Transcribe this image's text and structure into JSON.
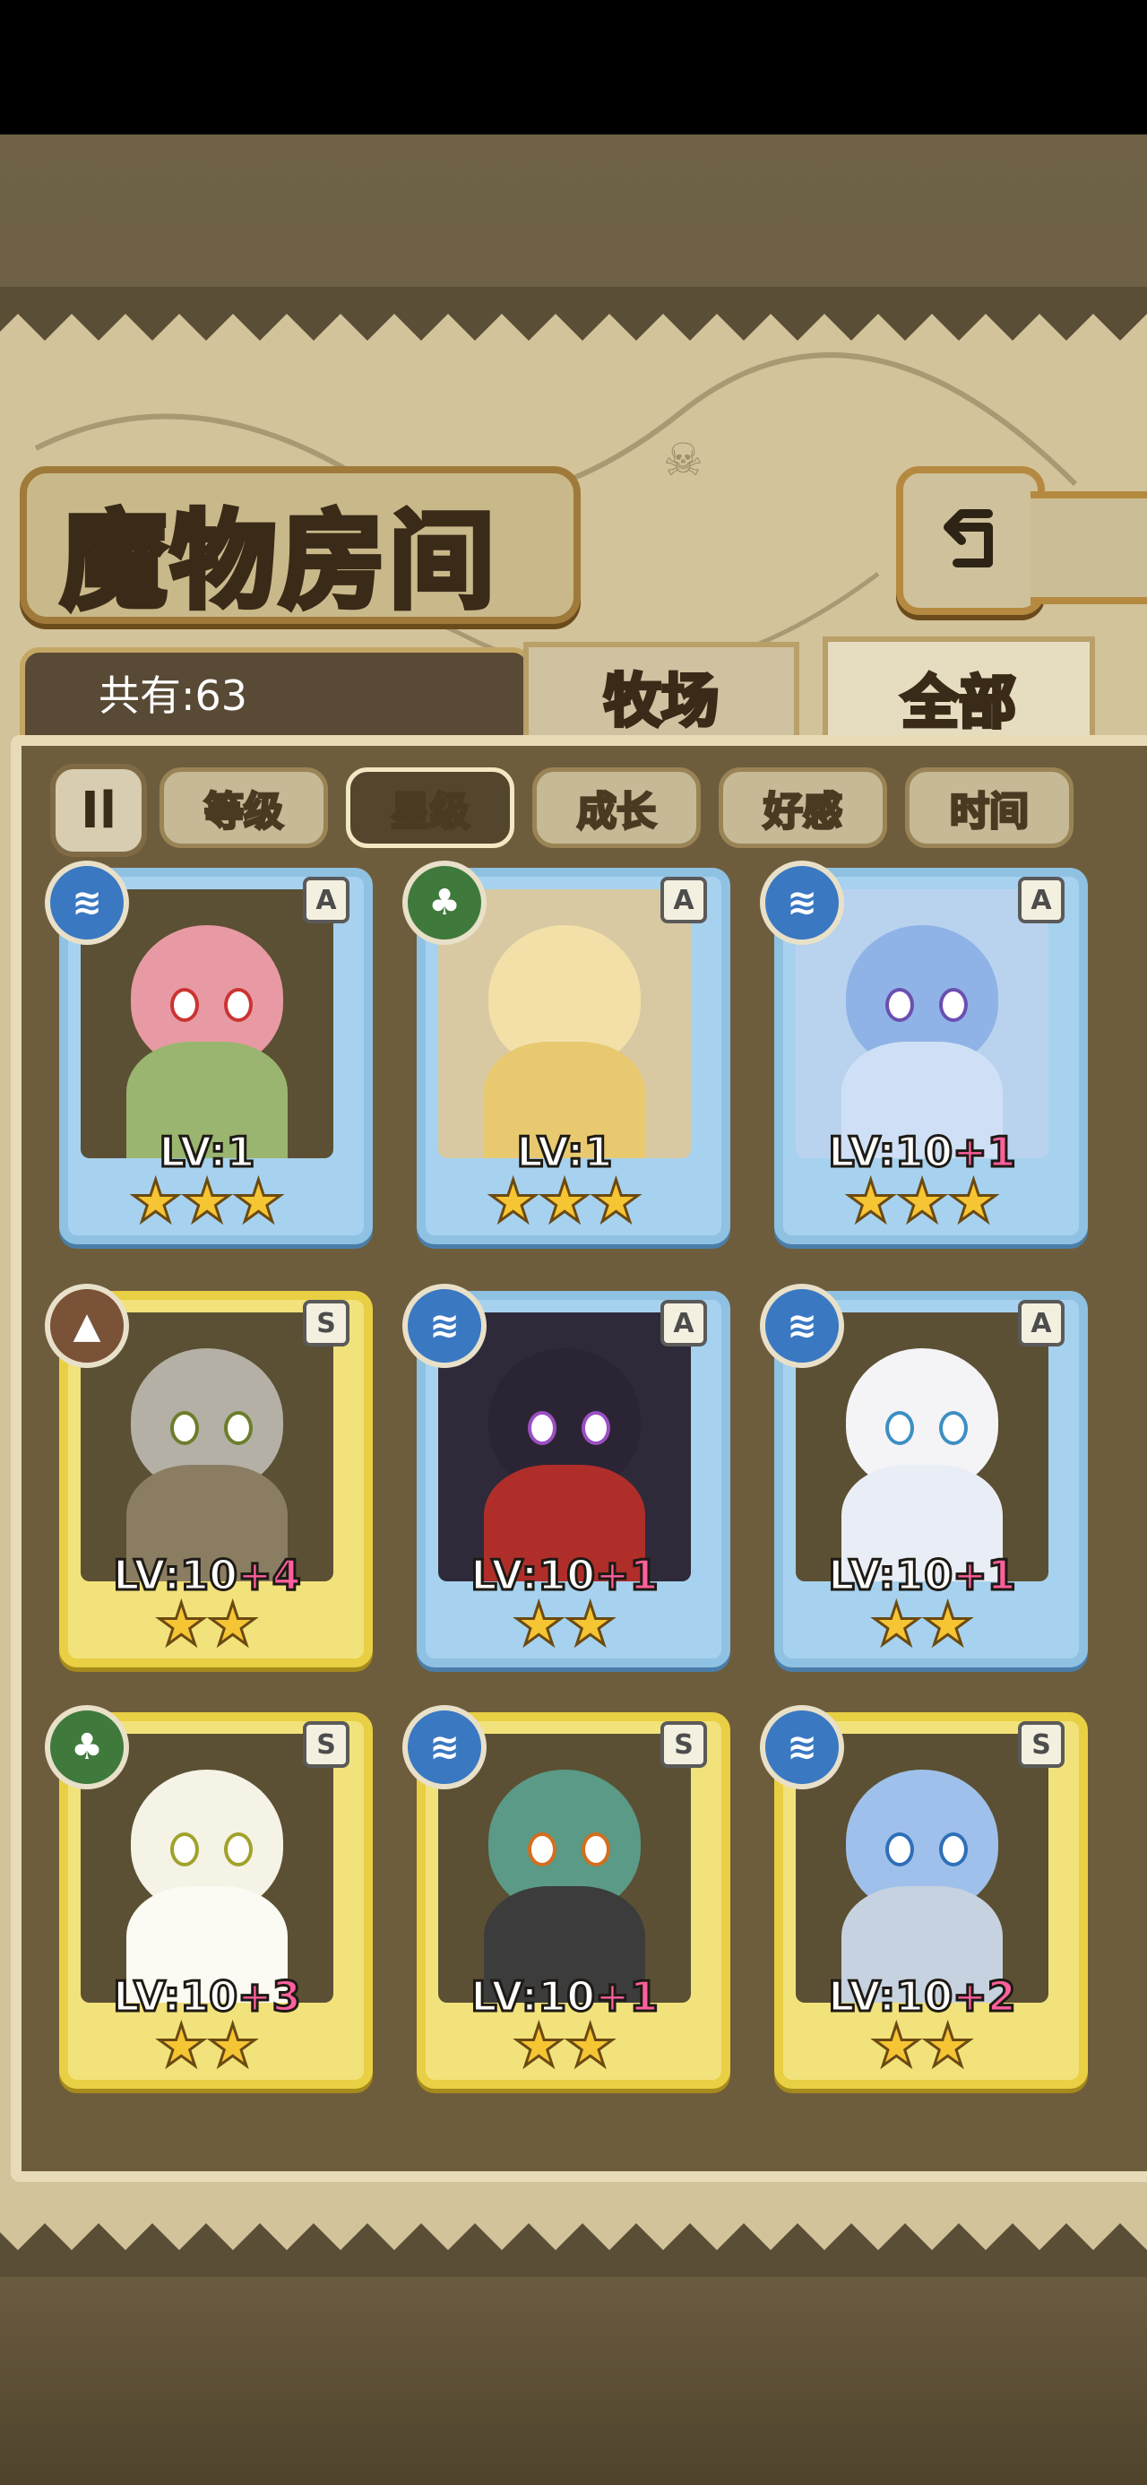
{
  "header": {
    "title": "魔物房间",
    "back_icon": "back-arrow-icon"
  },
  "tabs": {
    "count_label": "共有:63",
    "ranch": "牧场",
    "all": "全部"
  },
  "filters": {
    "toggle_icon": "sort-order-icon",
    "toggle_symbol": "Il",
    "items": [
      "等级",
      "星级",
      "成长",
      "好感",
      "时间"
    ],
    "active": "星级"
  },
  "monsters": [
    {
      "element": "water",
      "rank": "A",
      "level": "LV:1",
      "bonus": "",
      "stars": "★★★"
    },
    {
      "element": "wood",
      "rank": "A",
      "level": "LV:1",
      "bonus": "",
      "stars": "★★★"
    },
    {
      "element": "water",
      "rank": "A",
      "level": "LV:10",
      "bonus": "+1",
      "stars": "★★★"
    },
    {
      "element": "earth",
      "rank": "S",
      "level": "LV:10",
      "bonus": "+4",
      "stars": "★★"
    },
    {
      "element": "water",
      "rank": "A",
      "level": "LV:10",
      "bonus": "+1",
      "stars": "★★"
    },
    {
      "element": "water",
      "rank": "A",
      "level": "LV:10",
      "bonus": "+1",
      "stars": "★★"
    },
    {
      "element": "wood",
      "rank": "S",
      "level": "LV:10",
      "bonus": "+3",
      "stars": "★★"
    },
    {
      "element": "water",
      "rank": "S",
      "level": "LV:10",
      "bonus": "+1",
      "stars": "★★"
    },
    {
      "element": "water",
      "rank": "S",
      "level": "LV:10",
      "bonus": "+2",
      "stars": "★★"
    }
  ],
  "colors": {
    "water": "#3a78c2",
    "wood": "#3f7a3c",
    "earth": "#7a5238",
    "blue_frame": "#8fc1e2",
    "gold_frame": "#e9cf43",
    "plus_level": "#ff5f9d"
  }
}
